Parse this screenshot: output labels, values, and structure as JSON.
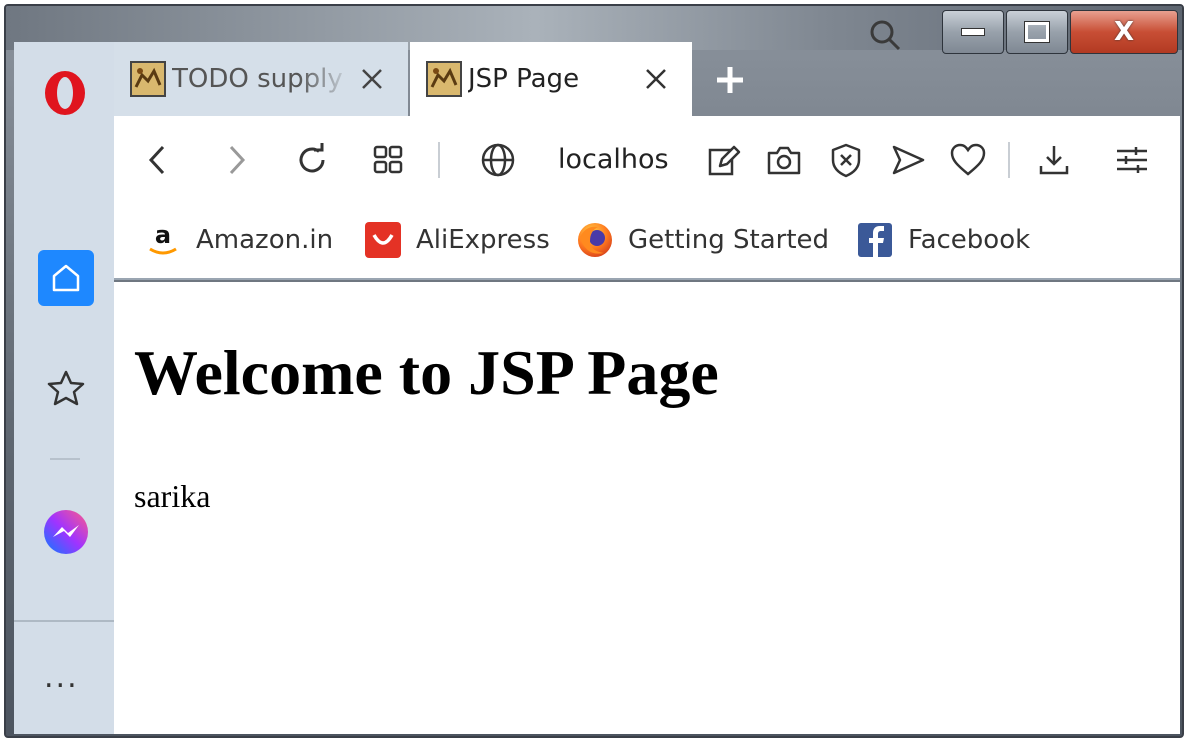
{
  "window": {
    "controls": {
      "minimize": "minimize",
      "maximize": "maximize",
      "close": "X"
    }
  },
  "tabs": [
    {
      "title": "TODO supply",
      "active": false
    },
    {
      "title": "JSP Page",
      "active": true
    }
  ],
  "address_bar": {
    "url": "localhos"
  },
  "bookmarks": [
    {
      "label": "Amazon.in",
      "icon": "amazon-icon"
    },
    {
      "label": "AliExpress",
      "icon": "aliexpress-icon"
    },
    {
      "label": "Getting Started",
      "icon": "firefox-icon"
    },
    {
      "label": "Facebook",
      "icon": "facebook-icon"
    }
  ],
  "sidebar": {
    "items": [
      "opera-logo",
      "home-icon",
      "star-icon",
      "messenger-icon",
      "more-icon"
    ],
    "more_label": "..."
  },
  "page": {
    "heading": "Welcome to JSP Page",
    "text": "sarika"
  },
  "colors": {
    "accent": "#1e88ff",
    "opera_red": "#e0141e",
    "close_red": "#c84e35",
    "aliexpress": "#e43225",
    "facebook": "#3b5998"
  }
}
